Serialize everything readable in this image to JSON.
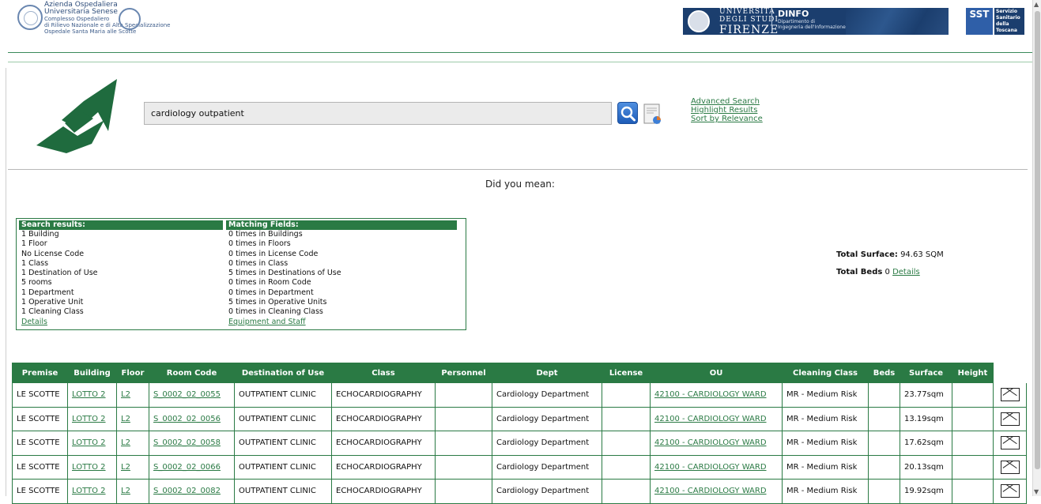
{
  "header": {
    "aou_lines": [
      "Azienda Ospedaliera",
      "Universitaria Senese",
      "Complesso Ospedaliero",
      "di Rilievo Nazionale e di Alta Specializzazione",
      "Ospedale Santa Maria alle Scotte"
    ],
    "unifi_line1": "UNIVERSITÀ",
    "unifi_line2": "DEGLI STUDI",
    "unifi_line3": "FIRENZE",
    "dinfo_title": "DINFO",
    "dinfo_line1": "Dipartimento di",
    "dinfo_line2": "Ingegneria dell'Informazione",
    "sst_abbr": "SST",
    "sst_lines": [
      "Servizio",
      "Sanitario",
      "della",
      "Toscana"
    ]
  },
  "search": {
    "query": "cardiology outpatient",
    "links": [
      "Advanced Search",
      "Highlight Results",
      "Sort by Relevance"
    ],
    "did_you_mean": "Did you mean:"
  },
  "summary": {
    "results_header": "Search results:",
    "results": [
      "1 Building",
      "1 Floor",
      "No License Code",
      "1 Class",
      "1 Destination of Use",
      "5 rooms",
      "1 Department",
      "1 Operative Unit",
      "1 Cleaning Class"
    ],
    "results_link": "Details",
    "fields_header": "Matching Fields:",
    "fields": [
      "0 times in Buildings",
      "0 times in Floors",
      "0 times in License Code",
      "0 times in Class",
      "5 times in Destinations of Use",
      "0 times in Room Code",
      "0 times in Department",
      "5 times in Operative Units",
      "0 times in Cleaning Class"
    ],
    "fields_link": "Equipment and Staff"
  },
  "totals": {
    "surface_label": "Total Surface:",
    "surface_value": "94.63 SQM",
    "beds_label": "Total Beds",
    "beds_value": "0",
    "beds_link": "Details"
  },
  "table": {
    "columns": [
      "Premise",
      "Building",
      "Floor",
      "Room Code",
      "Destination of Use",
      "Class",
      "Personnel",
      "Dept",
      "License",
      "OU",
      "Cleaning Class",
      "Beds",
      "Surface",
      "Height"
    ],
    "rows": [
      {
        "premise": "LE SCOTTE",
        "building": "LOTTO 2",
        "floor": "L2",
        "room": "S_0002_02_0055",
        "dest": "OUTPATIENT CLINIC",
        "class": "ECHOCARDIOGRAPHY",
        "personnel": "",
        "dept": "Cardiology Department",
        "license": "",
        "ou": "42100 - CARDIOLOGY WARD",
        "cleaning": "MR - Medium Risk",
        "beds": "",
        "surface": "23.77sqm",
        "height": ""
      },
      {
        "premise": "LE SCOTTE",
        "building": "LOTTO 2",
        "floor": "L2",
        "room": "S_0002_02_0056",
        "dest": "OUTPATIENT CLINIC",
        "class": "ECHOCARDIOGRAPHY",
        "personnel": "",
        "dept": "Cardiology Department",
        "license": "",
        "ou": "42100 - CARDIOLOGY WARD",
        "cleaning": "MR - Medium Risk",
        "beds": "",
        "surface": "13.19sqm",
        "height": ""
      },
      {
        "premise": "LE SCOTTE",
        "building": "LOTTO 2",
        "floor": "L2",
        "room": "S_0002_02_0058",
        "dest": "OUTPATIENT CLINIC",
        "class": "ECHOCARDIOGRAPHY",
        "personnel": "",
        "dept": "Cardiology Department",
        "license": "",
        "ou": "42100 - CARDIOLOGY WARD",
        "cleaning": "MR - Medium Risk",
        "beds": "",
        "surface": "17.62sqm",
        "height": ""
      },
      {
        "premise": "LE SCOTTE",
        "building": "LOTTO 2",
        "floor": "L2",
        "room": "S_0002_02_0066",
        "dest": "OUTPATIENT CLINIC",
        "class": "ECHOCARDIOGRAPHY",
        "personnel": "",
        "dept": "Cardiology Department",
        "license": "",
        "ou": "42100 - CARDIOLOGY WARD",
        "cleaning": "MR - Medium Risk",
        "beds": "",
        "surface": "20.13sqm",
        "height": ""
      },
      {
        "premise": "LE SCOTTE",
        "building": "LOTTO 2",
        "floor": "L2",
        "room": "S_0002_02_0082",
        "dest": "OUTPATIENT CLINIC",
        "class": "ECHOCARDIOGRAPHY",
        "personnel": "",
        "dept": "Cardiology Department",
        "license": "",
        "ou": "42100 - CARDIOLOGY WARD",
        "cleaning": "MR - Medium Risk",
        "beds": "",
        "surface": "19.92sqm",
        "height": ""
      }
    ]
  },
  "colors": {
    "brand_green": "#2a7a44",
    "unifi_blue": "#1b3e6e"
  }
}
